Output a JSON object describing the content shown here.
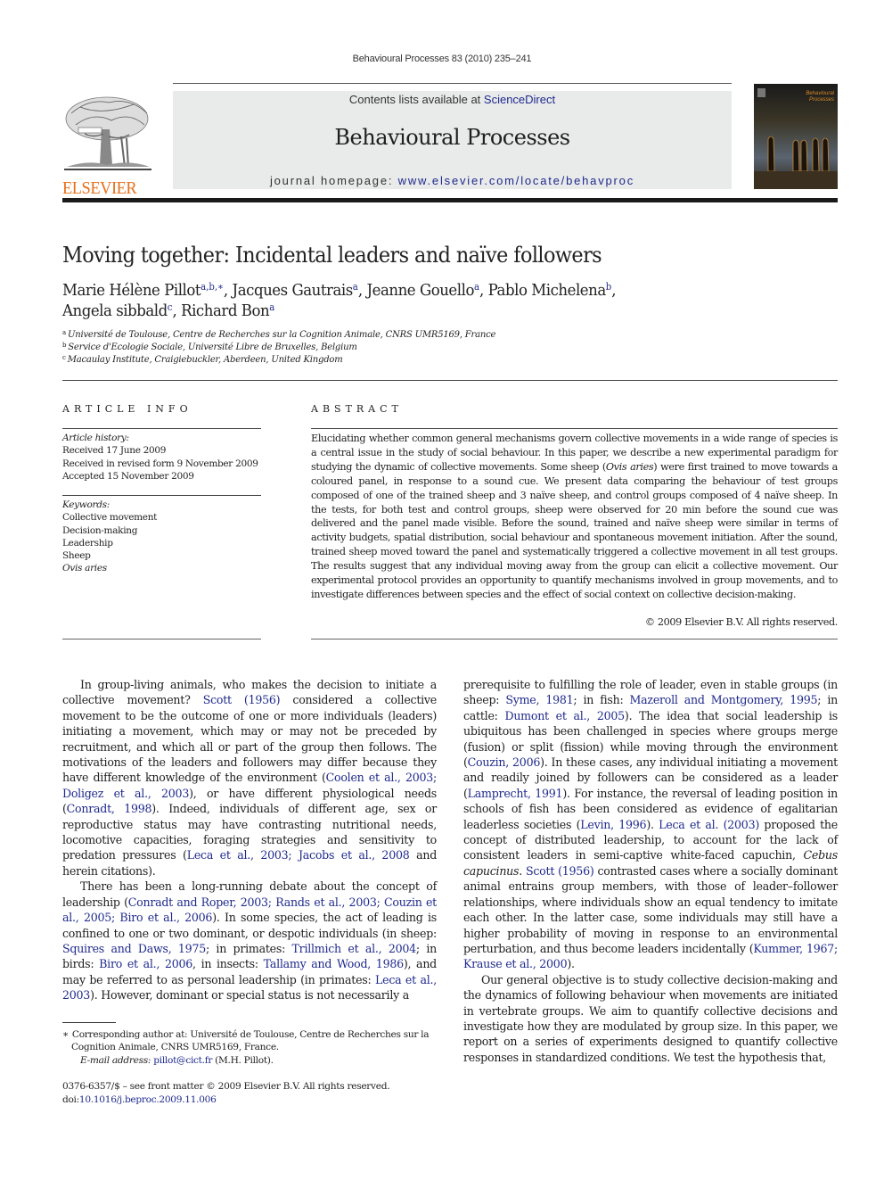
{
  "running_header": "Behavioural Processes 83 (2010) 235–241",
  "masthead": {
    "publisher_logo_text": "ELSEVIER",
    "contents_prefix": "Contents lists available at ",
    "contents_link": "ScienceDirect",
    "journal_title": "Behavioural Processes",
    "homepage_prefix": "journal homepage: ",
    "homepage_link": "www.elsevier.com/locate/behavproc",
    "cover_title_line1": "Behavioural",
    "cover_title_line2": "Processes"
  },
  "article": {
    "title": "Moving together: Incidental leaders and naïve followers",
    "authors": [
      {
        "name": "Marie Hélène Pillot",
        "sup": "a,b,∗",
        "sep": ", "
      },
      {
        "name": "Jacques Gautrais",
        "sup": "a",
        "sep": ", "
      },
      {
        "name": "Jeanne Gouello",
        "sup": "a",
        "sep": ", "
      },
      {
        "name": "Pablo Michelena",
        "sup": "b",
        "sep": ","
      },
      {
        "name": "Angela sibbald",
        "sup": "c",
        "sep": ", "
      },
      {
        "name": "Richard Bon",
        "sup": "a",
        "sep": ""
      }
    ],
    "affiliations": [
      {
        "key": "a",
        "text": "Université de Toulouse, Centre de Recherches sur la Cognition Animale, CNRS UMR5169, France"
      },
      {
        "key": "b",
        "text": "Service d'Ecologie Sociale, Université Libre de Bruxelles, Belgium"
      },
      {
        "key": "c",
        "text": "Macaulay Institute, Craigiebuckler, Aberdeen, United Kingdom"
      }
    ]
  },
  "article_info": {
    "heading": "ARTICLE INFO",
    "history_label": "Article history:",
    "history": [
      "Received 17 June 2009",
      "Received in revised form 9 November 2009",
      "Accepted 15 November 2009"
    ],
    "keywords_label": "Keywords:",
    "keywords": [
      "Collective movement",
      "Decision-making",
      "Leadership",
      "Sheep",
      "Ovis aries"
    ]
  },
  "abstract": {
    "heading": "ABSTRACT",
    "text_1": "Elucidating whether common general mechanisms govern collective movements in a wide range of species is a central issue in the study of social behaviour. In this paper, we describe a new experimental paradigm for studying the dynamic of collective movements. Some sheep (",
    "species": "Ovis aries",
    "text_2": ") were first trained to move towards a coloured panel, in response to a sound cue. We present data comparing the behaviour of test groups composed of one of the trained sheep and 3 naïve sheep, and control groups composed of 4 naïve sheep. In the tests, for both test and control groups, sheep were observed for 20 min before the sound cue was delivered and the panel made visible. Before the sound, trained and naïve sheep were similar in terms of activity budgets, spatial distribution, social behaviour and spontaneous movement initiation. After the sound, trained sheep moved toward the panel and systematically triggered a collective movement in all test groups. The results suggest that any individual moving away from the group can elicit a collective movement. Our experimental protocol provides an opportunity to quantify mechanisms involved in group movements, and to investigate differences between species and the effect of social context on collective decision-making.",
    "copyright": "© 2009 Elsevier B.V. All rights reserved."
  },
  "body": {
    "left": {
      "p1": [
        {
          "t": "In group-living animals, who makes the decision to initiate a collective movement? "
        },
        {
          "l": "Scott (1956)"
        },
        {
          "t": " considered a collective movement to be the outcome of one or more individuals (leaders) initiating a movement, which may or may not be preceded by recruitment, and which all or part of the group then follows. The motivations of the leaders and followers may differ because they have different knowledge of the environment ("
        },
        {
          "l": "Coolen et al., 2003; Doligez et al., 2003"
        },
        {
          "t": "), or have different physiological needs ("
        },
        {
          "l": "Conradt, 1998"
        },
        {
          "t": "). Indeed, individuals of different age, sex or reproductive status may have contrasting nutritional needs, locomotive capacities, foraging strategies and sensitivity to predation pressures ("
        },
        {
          "l": "Leca et al., 2003; Jacobs et al., 2008"
        },
        {
          "t": " and herein citations)."
        }
      ],
      "p2": [
        {
          "t": "There has been a long-running debate about the concept of leadership ("
        },
        {
          "l": "Conradt and Roper, 2003; Rands et al., 2003; Couzin et al., 2005; Biro et al., 2006"
        },
        {
          "t": "). In some species, the act of leading is confined to one or two dominant, or despotic individuals (in sheep: "
        },
        {
          "l": "Squires and Daws, 1975"
        },
        {
          "t": "; in primates: "
        },
        {
          "l": "Trillmich et al., 2004"
        },
        {
          "t": "; in birds: "
        },
        {
          "l": "Biro et al., 2006"
        },
        {
          "t": ", in insects: "
        },
        {
          "l": "Tallamy and Wood, 1986"
        },
        {
          "t": "), and may be referred to as personal leadership (in primates: "
        },
        {
          "l": "Leca et al., 2003"
        },
        {
          "t": "). However, dominant or special status is not necessarily a"
        }
      ]
    },
    "right": {
      "p1": [
        {
          "t": "prerequisite to fulfilling the role of leader, even in stable groups (in sheep: "
        },
        {
          "l": "Syme, 1981"
        },
        {
          "t": "; in fish: "
        },
        {
          "l": "Mazeroll and Montgomery, 1995"
        },
        {
          "t": "; in cattle: "
        },
        {
          "l": "Dumont et al., 2005"
        },
        {
          "t": "). The idea that social leadership is ubiquitous has been challenged in species where groups merge (fusion) or split (fission) while moving through the environment ("
        },
        {
          "l": "Couzin, 2006"
        },
        {
          "t": "). In these cases, any individual initiating a movement and readily joined by followers can be considered as a leader ("
        },
        {
          "l": "Lamprecht, 1991"
        },
        {
          "t": "). For instance, the reversal of leading position in schools of fish has been considered as evidence of egalitarian leaderless societies ("
        },
        {
          "l": "Levin, 1996"
        },
        {
          "t": "). "
        },
        {
          "l": "Leca et al. (2003)"
        },
        {
          "t": " proposed the concept of distributed leadership, to account for the lack of consistent leaders in semi-captive white-faced capuchin, "
        },
        {
          "i": "Cebus capucinus"
        },
        {
          "t": ". "
        },
        {
          "l": "Scott (1956)"
        },
        {
          "t": " contrasted cases where a socially dominant animal entrains group members, with those of leader–follower relationships, where individuals show an equal tendency to imitate each other. In the latter case, some individuals may still have a higher probability of moving in response to an environmental perturbation, and thus become leaders incidentally ("
        },
        {
          "l": "Kummer, 1967; Krause et al., 2000"
        },
        {
          "t": ")."
        }
      ],
      "p2": [
        {
          "t": "Our general objective is to study collective decision-making and the dynamics of following behaviour when movements are initiated in vertebrate groups. We aim to quantify collective decisions and investigate how they are modulated by group size. In this paper, we report on a series of experiments designed to quantify collective responses in standardized conditions. We test the hypothesis that,"
        }
      ]
    }
  },
  "footnote": {
    "marker": "∗",
    "corresponding": "Corresponding author at: Université de Toulouse, Centre de Recherches sur la Cognition Animale, CNRS UMR5169, France.",
    "email_label": "E-mail address:",
    "email": "pillot@cict.fr",
    "email_suffix": " (M.H. Pillot)."
  },
  "imprint": {
    "line1": "0376-6357/$ – see front matter © 2009 Elsevier B.V. All rights reserved.",
    "doi_prefix": "doi:",
    "doi": "10.1016/j.beproc.2009.11.006"
  },
  "colors": {
    "link": "#1f2a8c",
    "elsevier_orange": "#e86f18",
    "masthead_bg": "#e9eaea"
  }
}
